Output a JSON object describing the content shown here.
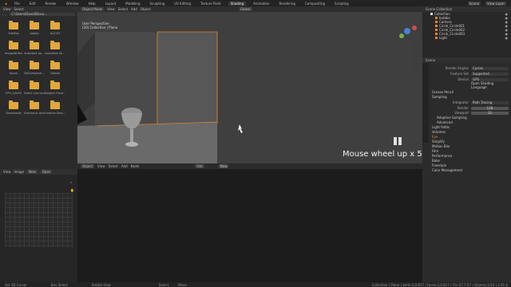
{
  "topbar": {
    "menus": [
      "File",
      "Edit",
      "Render",
      "Window",
      "Help"
    ],
    "workspaces": [
      "Layout",
      "Modeling",
      "Sculpting",
      "UV Editing",
      "Texture Paint",
      "Shading",
      "Animation",
      "Rendering",
      "Compositing",
      "Scripting"
    ],
    "active_workspace": "Shading",
    "scene": "Scene",
    "view_layer": "View Layer"
  },
  "filebrowser": {
    "menus": [
      "View",
      "Select"
    ],
    "path": "C:\\Users\\David\\Docu...",
    "folders": [
      "3dsMax",
      "Adobe",
      "ALICE3",
      "ImageWrites",
      "Autodesk Ap...",
      "Autodesk Sk...",
      "bsrod",
      "DAComposer...",
      "Dolska",
      "CPU_SAVES",
      "Direct Connect",
      "Dolphin Emul...",
      "Downloads",
      "Electronic Arts",
      "Freeline Desi..."
    ]
  },
  "imageeditor": {
    "menus": [
      "View",
      "Image"
    ],
    "new_label": "New",
    "open_label": "Open"
  },
  "viewport": {
    "mode": "Object Mode",
    "menus": [
      "View",
      "Select",
      "Add",
      "Object"
    ],
    "transform": "Global",
    "info_line1": "User Perspective",
    "info_line2": "(20) Collection | Plane",
    "overlay_text": "Mouse wheel up x 5"
  },
  "nodeeditor": {
    "mode": "Object",
    "menus": [
      "View",
      "Select",
      "Add",
      "Node"
    ],
    "slot": "Slot",
    "new_label": "New"
  },
  "outliner": {
    "title": "Scene Collection",
    "items": [
      "Collection",
      "bubble",
      "Camera",
      "Circle_Circle001",
      "Circle_Circle002",
      "Circle_Circle003",
      "Light"
    ]
  },
  "properties": {
    "scene_label": "Scene",
    "render_engine_label": "Render Engine",
    "render_engine": "Cycles",
    "feature_set_label": "Feature Set",
    "feature_set": "Supported",
    "device_label": "Device",
    "device": "GPU",
    "open_shading_language": "Open Shading Language",
    "sections": [
      "Grease Pencil",
      "Sampling",
      "Light Paths",
      "Volumes",
      "Eye",
      "Simplify",
      "Motion Blur",
      "Film",
      "Performance",
      "Bake",
      "Freestyle",
      "Color Management"
    ],
    "integrator_label": "Integrator",
    "integrator": "Path Tracing",
    "render_label": "Render",
    "render_value": "128",
    "viewport_label": "Viewport",
    "viewport_value": "32",
    "adaptive_sampling": "Adaptive Sampling",
    "advanced": "Advanced"
  },
  "statusbar": {
    "left": "Set 3D Cursor",
    "mid1": "Box Select",
    "mid2": "Rotate View",
    "mid3": "Select",
    "mid4": "Move",
    "right": "Collection | Plane | Verts:2,0:817 | Faces:2,0:817 | Tris:27,7:57 | Objects:1/10 | 2.91.0"
  },
  "colors": {
    "accent": "#4a7fd6",
    "active_orange": "#e4872a",
    "folder": "#e2a83d"
  }
}
